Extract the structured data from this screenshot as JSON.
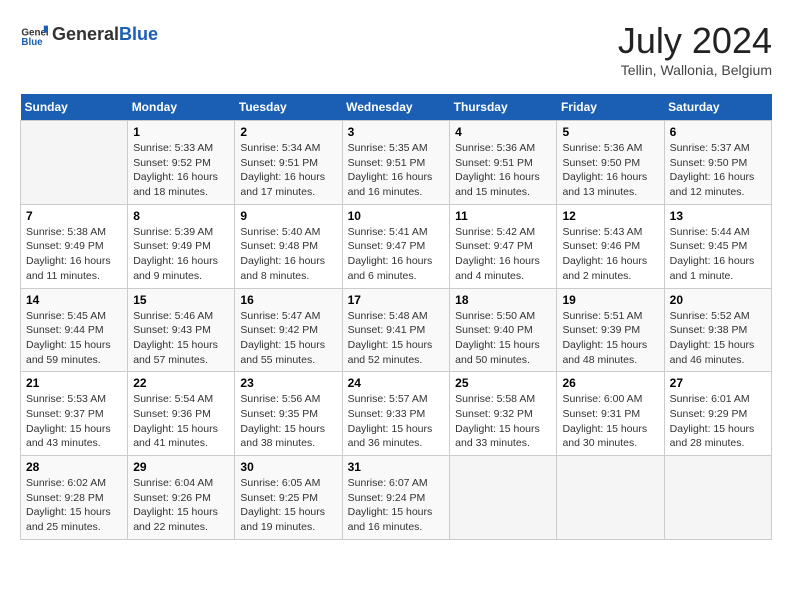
{
  "header": {
    "logo_general": "General",
    "logo_blue": "Blue",
    "title": "July 2024",
    "location": "Tellin, Wallonia, Belgium"
  },
  "days_of_week": [
    "Sunday",
    "Monday",
    "Tuesday",
    "Wednesday",
    "Thursday",
    "Friday",
    "Saturday"
  ],
  "weeks": [
    [
      {
        "day": "",
        "sunrise": "",
        "sunset": "",
        "daylight": ""
      },
      {
        "day": "1",
        "sunrise": "Sunrise: 5:33 AM",
        "sunset": "Sunset: 9:52 PM",
        "daylight": "Daylight: 16 hours and 18 minutes."
      },
      {
        "day": "2",
        "sunrise": "Sunrise: 5:34 AM",
        "sunset": "Sunset: 9:51 PM",
        "daylight": "Daylight: 16 hours and 17 minutes."
      },
      {
        "day": "3",
        "sunrise": "Sunrise: 5:35 AM",
        "sunset": "Sunset: 9:51 PM",
        "daylight": "Daylight: 16 hours and 16 minutes."
      },
      {
        "day": "4",
        "sunrise": "Sunrise: 5:36 AM",
        "sunset": "Sunset: 9:51 PM",
        "daylight": "Daylight: 16 hours and 15 minutes."
      },
      {
        "day": "5",
        "sunrise": "Sunrise: 5:36 AM",
        "sunset": "Sunset: 9:50 PM",
        "daylight": "Daylight: 16 hours and 13 minutes."
      },
      {
        "day": "6",
        "sunrise": "Sunrise: 5:37 AM",
        "sunset": "Sunset: 9:50 PM",
        "daylight": "Daylight: 16 hours and 12 minutes."
      }
    ],
    [
      {
        "day": "7",
        "sunrise": "Sunrise: 5:38 AM",
        "sunset": "Sunset: 9:49 PM",
        "daylight": "Daylight: 16 hours and 11 minutes."
      },
      {
        "day": "8",
        "sunrise": "Sunrise: 5:39 AM",
        "sunset": "Sunset: 9:49 PM",
        "daylight": "Daylight: 16 hours and 9 minutes."
      },
      {
        "day": "9",
        "sunrise": "Sunrise: 5:40 AM",
        "sunset": "Sunset: 9:48 PM",
        "daylight": "Daylight: 16 hours and 8 minutes."
      },
      {
        "day": "10",
        "sunrise": "Sunrise: 5:41 AM",
        "sunset": "Sunset: 9:47 PM",
        "daylight": "Daylight: 16 hours and 6 minutes."
      },
      {
        "day": "11",
        "sunrise": "Sunrise: 5:42 AM",
        "sunset": "Sunset: 9:47 PM",
        "daylight": "Daylight: 16 hours and 4 minutes."
      },
      {
        "day": "12",
        "sunrise": "Sunrise: 5:43 AM",
        "sunset": "Sunset: 9:46 PM",
        "daylight": "Daylight: 16 hours and 2 minutes."
      },
      {
        "day": "13",
        "sunrise": "Sunrise: 5:44 AM",
        "sunset": "Sunset: 9:45 PM",
        "daylight": "Daylight: 16 hours and 1 minute."
      }
    ],
    [
      {
        "day": "14",
        "sunrise": "Sunrise: 5:45 AM",
        "sunset": "Sunset: 9:44 PM",
        "daylight": "Daylight: 15 hours and 59 minutes."
      },
      {
        "day": "15",
        "sunrise": "Sunrise: 5:46 AM",
        "sunset": "Sunset: 9:43 PM",
        "daylight": "Daylight: 15 hours and 57 minutes."
      },
      {
        "day": "16",
        "sunrise": "Sunrise: 5:47 AM",
        "sunset": "Sunset: 9:42 PM",
        "daylight": "Daylight: 15 hours and 55 minutes."
      },
      {
        "day": "17",
        "sunrise": "Sunrise: 5:48 AM",
        "sunset": "Sunset: 9:41 PM",
        "daylight": "Daylight: 15 hours and 52 minutes."
      },
      {
        "day": "18",
        "sunrise": "Sunrise: 5:50 AM",
        "sunset": "Sunset: 9:40 PM",
        "daylight": "Daylight: 15 hours and 50 minutes."
      },
      {
        "day": "19",
        "sunrise": "Sunrise: 5:51 AM",
        "sunset": "Sunset: 9:39 PM",
        "daylight": "Daylight: 15 hours and 48 minutes."
      },
      {
        "day": "20",
        "sunrise": "Sunrise: 5:52 AM",
        "sunset": "Sunset: 9:38 PM",
        "daylight": "Daylight: 15 hours and 46 minutes."
      }
    ],
    [
      {
        "day": "21",
        "sunrise": "Sunrise: 5:53 AM",
        "sunset": "Sunset: 9:37 PM",
        "daylight": "Daylight: 15 hours and 43 minutes."
      },
      {
        "day": "22",
        "sunrise": "Sunrise: 5:54 AM",
        "sunset": "Sunset: 9:36 PM",
        "daylight": "Daylight: 15 hours and 41 minutes."
      },
      {
        "day": "23",
        "sunrise": "Sunrise: 5:56 AM",
        "sunset": "Sunset: 9:35 PM",
        "daylight": "Daylight: 15 hours and 38 minutes."
      },
      {
        "day": "24",
        "sunrise": "Sunrise: 5:57 AM",
        "sunset": "Sunset: 9:33 PM",
        "daylight": "Daylight: 15 hours and 36 minutes."
      },
      {
        "day": "25",
        "sunrise": "Sunrise: 5:58 AM",
        "sunset": "Sunset: 9:32 PM",
        "daylight": "Daylight: 15 hours and 33 minutes."
      },
      {
        "day": "26",
        "sunrise": "Sunrise: 6:00 AM",
        "sunset": "Sunset: 9:31 PM",
        "daylight": "Daylight: 15 hours and 30 minutes."
      },
      {
        "day": "27",
        "sunrise": "Sunrise: 6:01 AM",
        "sunset": "Sunset: 9:29 PM",
        "daylight": "Daylight: 15 hours and 28 minutes."
      }
    ],
    [
      {
        "day": "28",
        "sunrise": "Sunrise: 6:02 AM",
        "sunset": "Sunset: 9:28 PM",
        "daylight": "Daylight: 15 hours and 25 minutes."
      },
      {
        "day": "29",
        "sunrise": "Sunrise: 6:04 AM",
        "sunset": "Sunset: 9:26 PM",
        "daylight": "Daylight: 15 hours and 22 minutes."
      },
      {
        "day": "30",
        "sunrise": "Sunrise: 6:05 AM",
        "sunset": "Sunset: 9:25 PM",
        "daylight": "Daylight: 15 hours and 19 minutes."
      },
      {
        "day": "31",
        "sunrise": "Sunrise: 6:07 AM",
        "sunset": "Sunset: 9:24 PM",
        "daylight": "Daylight: 15 hours and 16 minutes."
      },
      {
        "day": "",
        "sunrise": "",
        "sunset": "",
        "daylight": ""
      },
      {
        "day": "",
        "sunrise": "",
        "sunset": "",
        "daylight": ""
      },
      {
        "day": "",
        "sunrise": "",
        "sunset": "",
        "daylight": ""
      }
    ]
  ]
}
